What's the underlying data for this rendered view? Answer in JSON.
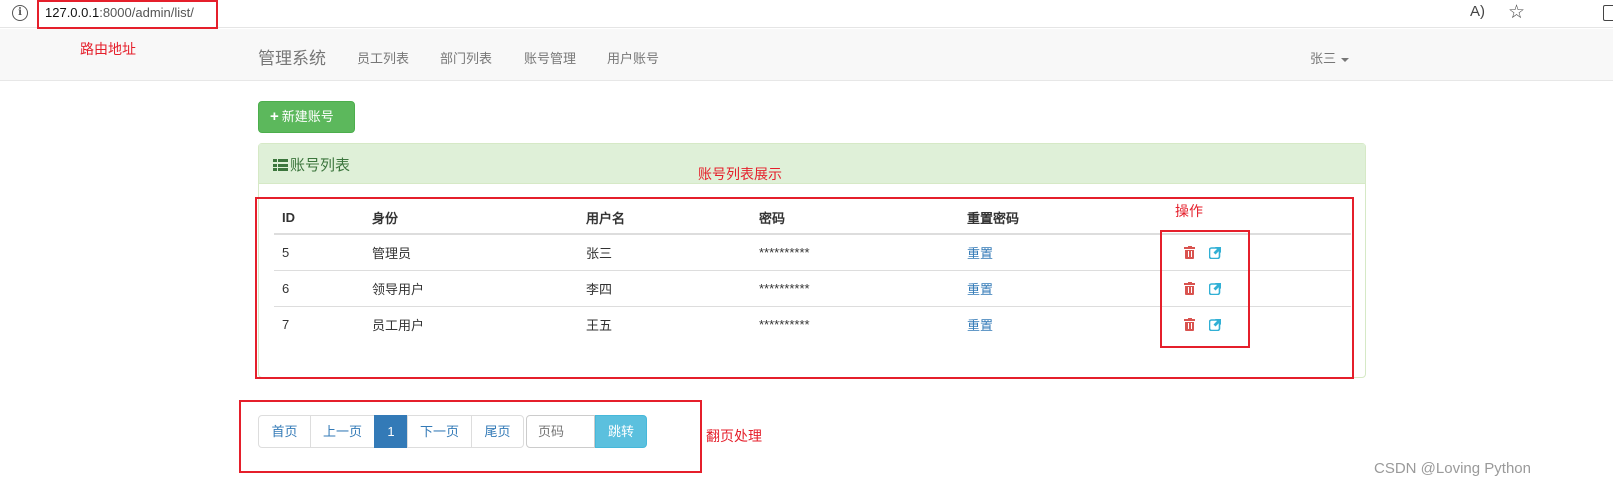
{
  "browser": {
    "url_host": "127.0.0.1",
    "url_path": ":8000/admin/list/",
    "info_icon": "i",
    "read_icon": "A)",
    "star_icon": "☆"
  },
  "navbar": {
    "brand": "管理系统",
    "links": [
      "员工列表",
      "部门列表",
      "账号管理",
      "用户账号"
    ],
    "user": "张三"
  },
  "new_button": {
    "label": "新建账号",
    "icon": "+"
  },
  "panel": {
    "title": "账号列表",
    "columns": [
      "ID",
      "身份",
      "用户名",
      "密码",
      "重置密码"
    ],
    "rows": [
      {
        "id": "5",
        "role": "管理员",
        "username": "张三",
        "password": "**********",
        "reset": "重置"
      },
      {
        "id": "6",
        "role": "领导用户",
        "username": "李四",
        "password": "**********",
        "reset": "重置"
      },
      {
        "id": "7",
        "role": "员工用户",
        "username": "王五",
        "password": "**********",
        "reset": "重置"
      }
    ]
  },
  "pagination": {
    "first": "首页",
    "prev": "上一页",
    "current": "1",
    "next": "下一页",
    "last": "尾页",
    "input_placeholder": "页码",
    "go": "跳转"
  },
  "annotations": {
    "route": "路由地址",
    "list_display": "账号列表展示",
    "actions": "操作",
    "paging": "翻页处理"
  },
  "watermark": "CSDN @Loving Python",
  "colors": {
    "success": "#5cb85c",
    "primary": "#337ab7",
    "danger": "#d9534f",
    "info": "#5bc0de",
    "annotation": "#e51f2b"
  }
}
